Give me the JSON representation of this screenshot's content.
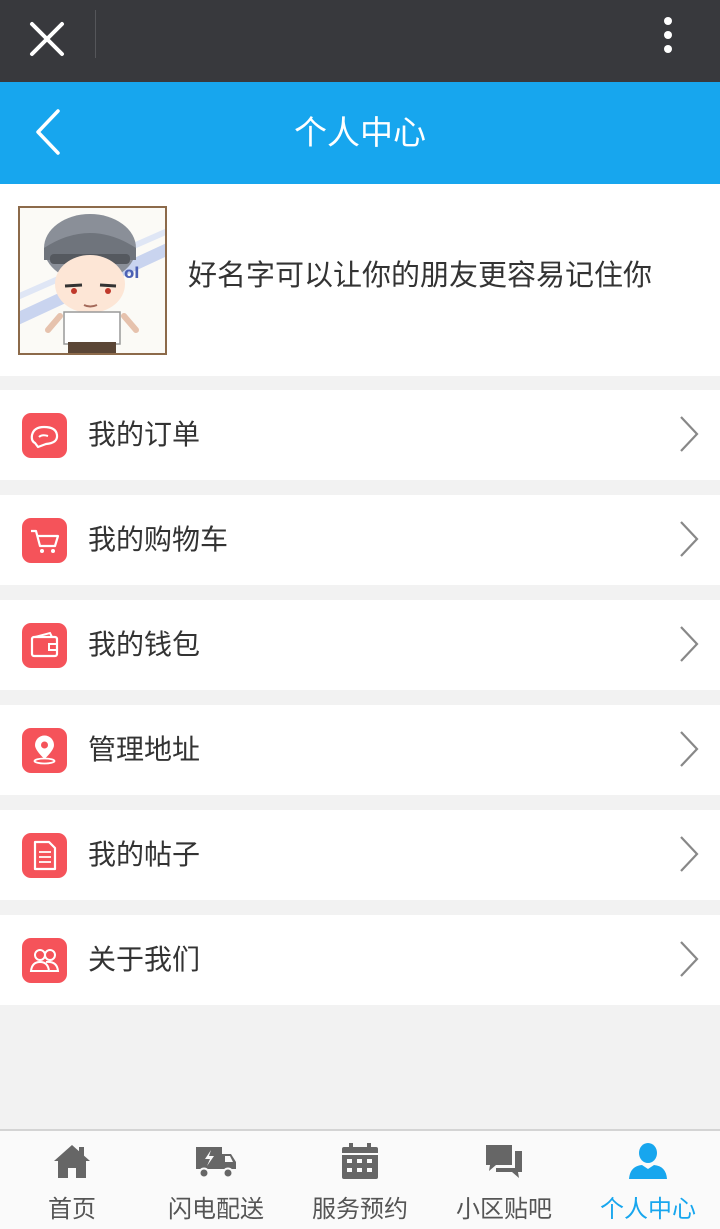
{
  "header": {
    "title": "个人中心"
  },
  "profile": {
    "nickname_hint": "好名字可以让你的朋友更容易记住你"
  },
  "menu": [
    {
      "label": "我的订单",
      "icon": "chat-bubble-icon"
    },
    {
      "label": "我的购物车",
      "icon": "cart-icon"
    },
    {
      "label": "我的钱包",
      "icon": "wallet-icon"
    },
    {
      "label": "管理地址",
      "icon": "location-pin-icon"
    },
    {
      "label": "我的帖子",
      "icon": "document-icon"
    },
    {
      "label": "关于我们",
      "icon": "users-icon"
    }
  ],
  "tabs": [
    {
      "label": "首页",
      "icon": "home-icon"
    },
    {
      "label": "闪电配送",
      "icon": "delivery-truck-icon"
    },
    {
      "label": "服务预约",
      "icon": "calendar-icon"
    },
    {
      "label": "小区贴吧",
      "icon": "chat-icon"
    },
    {
      "label": "个人中心",
      "icon": "person-icon",
      "active": true
    }
  ],
  "colors": {
    "accent": "#17a6ee",
    "icon_bg": "#f5535a",
    "topbar": "#38393d"
  }
}
